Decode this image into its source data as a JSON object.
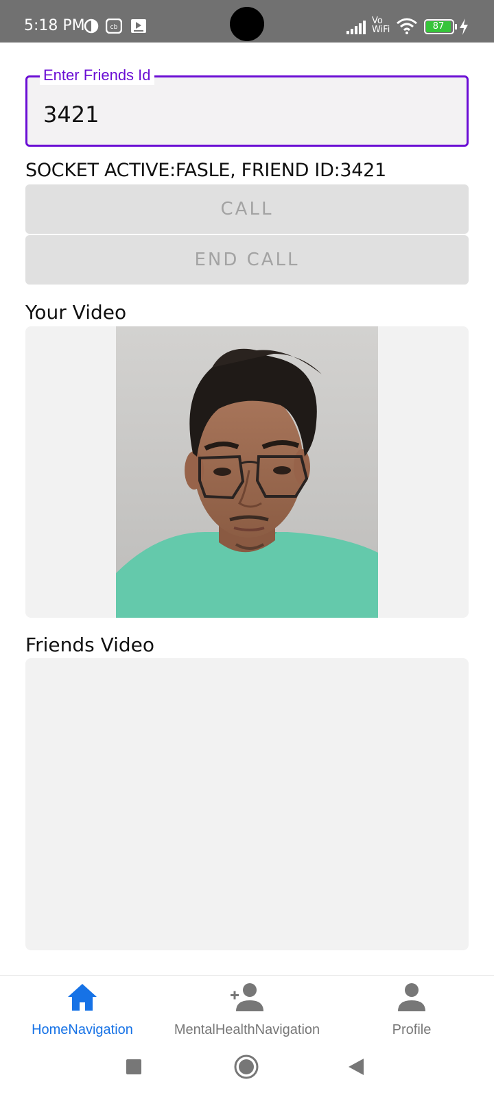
{
  "status_bar": {
    "time": "5:18 PM",
    "battery": "87",
    "network_label": "Vo WiFi",
    "icons": [
      "data-saver-icon",
      "cb-app-icon",
      "media-notification-icon",
      "signal-icon",
      "wifi-icon",
      "battery-icon",
      "charging-icon"
    ]
  },
  "friend_id_field": {
    "label": "Enter Friends Id",
    "value": "3421",
    "accent_color": "#6a0dd4"
  },
  "socket_status": "SOCKET ACTIVE:FASLE, FRIEND ID:3421",
  "buttons": {
    "call": "CALL",
    "end_call": "END CALL"
  },
  "your_video": {
    "label": "Your Video"
  },
  "friends_video": {
    "label": "Friends Video"
  },
  "bottom_nav": {
    "items": [
      {
        "label": "HomeNavigation",
        "icon": "home-icon",
        "active": true
      },
      {
        "label": "MentalHealthNavigation",
        "icon": "add-person-icon",
        "active": false
      },
      {
        "label": "Profile",
        "icon": "person-icon",
        "active": false
      }
    ],
    "active_color": "#1672e6"
  },
  "system_nav": {
    "icons": [
      "recents-square-icon",
      "home-circle-icon",
      "back-triangle-icon"
    ]
  }
}
